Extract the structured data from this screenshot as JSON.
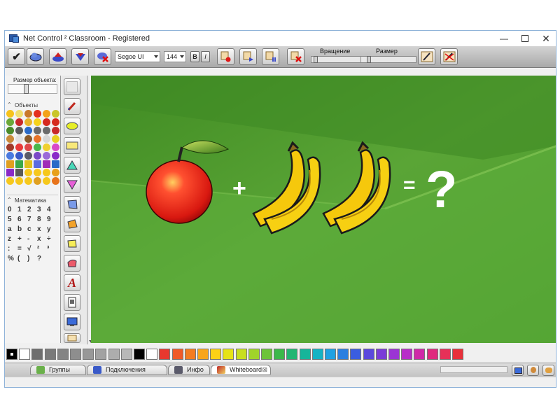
{
  "window": {
    "title": "Net Control ² Classroom - Registered",
    "controls": [
      "minimize-icon",
      "maximize-icon",
      "close-icon"
    ]
  },
  "toolbar": {
    "font_name": "Segoe UI",
    "font_size": "144",
    "bold_label": "B",
    "italic_label": "I",
    "rotation_label": "Вращение",
    "size_label": "Размер",
    "rotation_value": 0.05,
    "size_value": 0.1
  },
  "left_panel": {
    "object_size_label": "Размер объекта:",
    "objects_title": "Объекты",
    "math_title": "Математика",
    "math_symbols": [
      "0",
      "1",
      "2",
      "3",
      "4",
      "5",
      "6",
      "7",
      "8",
      "9",
      "a",
      "b",
      "c",
      "x",
      "y",
      "z",
      "+",
      "-",
      "x",
      "÷",
      ":",
      "=",
      "√",
      "²",
      "³",
      "%",
      "(",
      ")",
      "?",
      ""
    ]
  },
  "canvas": {
    "plus": "+",
    "equals": "=",
    "question": "?",
    "colors": {
      "sky": "#4f9a2f",
      "grass": "#5aa536",
      "apple": "#e02818",
      "banana": "#f3c512"
    }
  },
  "palette": {
    "colors": [
      "#000000",
      "#ffffff",
      "#6e6e6e",
      "#7a7a7a",
      "#848484",
      "#8e8e8e",
      "#989898",
      "#a2a2a2",
      "#adadad",
      "#b8b8b8",
      "#000000",
      "#ffffff",
      "#e8382e",
      "#f05a28",
      "#f47c20",
      "#f8a51c",
      "#fcd116",
      "#e6e317",
      "#c8de1e",
      "#a0d42a",
      "#6cc43a",
      "#3cb84a",
      "#22b573",
      "#16b59a",
      "#15b3c4",
      "#1fa1e3",
      "#2b7fe0",
      "#3a5de0",
      "#5a48dc",
      "#7a3ad8",
      "#9b34d4",
      "#b82ec8",
      "#d02aa8",
      "#e02a7e",
      "#e63058",
      "#e8303a"
    ],
    "selected": 0
  },
  "tabs": [
    {
      "label": "Группы",
      "icon": "groups-icon"
    },
    {
      "label": "Подключения",
      "icon": "connections-icon"
    },
    {
      "label": "Инфо",
      "icon": "info-icon"
    },
    {
      "label": "Whiteboard",
      "icon": "whiteboard-icon",
      "active": true
    }
  ],
  "tab_close": "⊠"
}
